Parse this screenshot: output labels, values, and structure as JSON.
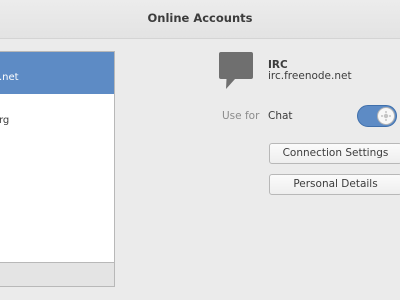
{
  "window": {
    "title": "Online Accounts"
  },
  "accounts": [
    {
      "label": ".net",
      "selected": true
    },
    {
      "label": "rg",
      "selected": false
    }
  ],
  "detail": {
    "provider_icon": "speech-bubble-icon",
    "provider_name": "IRC",
    "server": "irc.freenode.net",
    "use_for_label": "Use for",
    "service_label": "Chat",
    "service_enabled": true,
    "buttons": {
      "connection_settings": "Connection Settings",
      "personal_details": "Personal Details"
    }
  },
  "colors": {
    "accent": "#5d8bc5",
    "background": "#ebebeb"
  }
}
